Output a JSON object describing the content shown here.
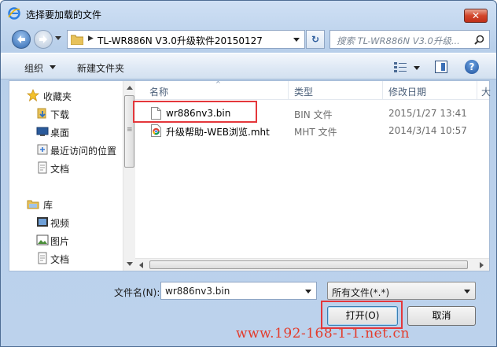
{
  "window": {
    "title": "选择要加载的文件",
    "close_label": "✕"
  },
  "address_bar": {
    "separator": "▶",
    "path": "TL-WR886N V3.0升级软件20150127"
  },
  "search": {
    "placeholder": "搜索 TL-WR886N V3.0升级..."
  },
  "toolbar": {
    "organize_label": "组织",
    "new_folder_label": "新建文件夹",
    "help_label": "?",
    "refresh_label": "↻"
  },
  "nav_pane": {
    "favorites": {
      "label": "收藏夹",
      "items": [
        {
          "label": "下载"
        },
        {
          "label": "桌面"
        },
        {
          "label": "最近访问的位置"
        },
        {
          "label": "文档"
        }
      ]
    },
    "libraries": {
      "label": "库",
      "items": [
        {
          "label": "视频"
        },
        {
          "label": "图片"
        },
        {
          "label": "文档"
        }
      ]
    },
    "scroll_mark": "≡"
  },
  "file_list": {
    "columns": [
      "名称",
      "类型",
      "修改日期",
      "大"
    ],
    "rows": [
      {
        "name": "wr886nv3.bin",
        "type": "BIN 文件",
        "modified": "2015/1/27 13:41",
        "icon": "file-icon"
      },
      {
        "name": "升级帮助-WEB浏览.mht",
        "type": "MHT 文件",
        "modified": "2014/3/14 10:57",
        "icon": "chrome-file-icon"
      }
    ]
  },
  "bottom": {
    "filename_label": "文件名(N):",
    "filename_value": "wr886nv3.bin",
    "filetype_value": "所有文件(*.*)",
    "open_label": "打开(O)",
    "cancel_label": "取消"
  },
  "watermark": "www.192-168-1-1.net.cn",
  "colors": {
    "highlight_red": "#e4373b",
    "watermark_red": "#e33c2c"
  }
}
